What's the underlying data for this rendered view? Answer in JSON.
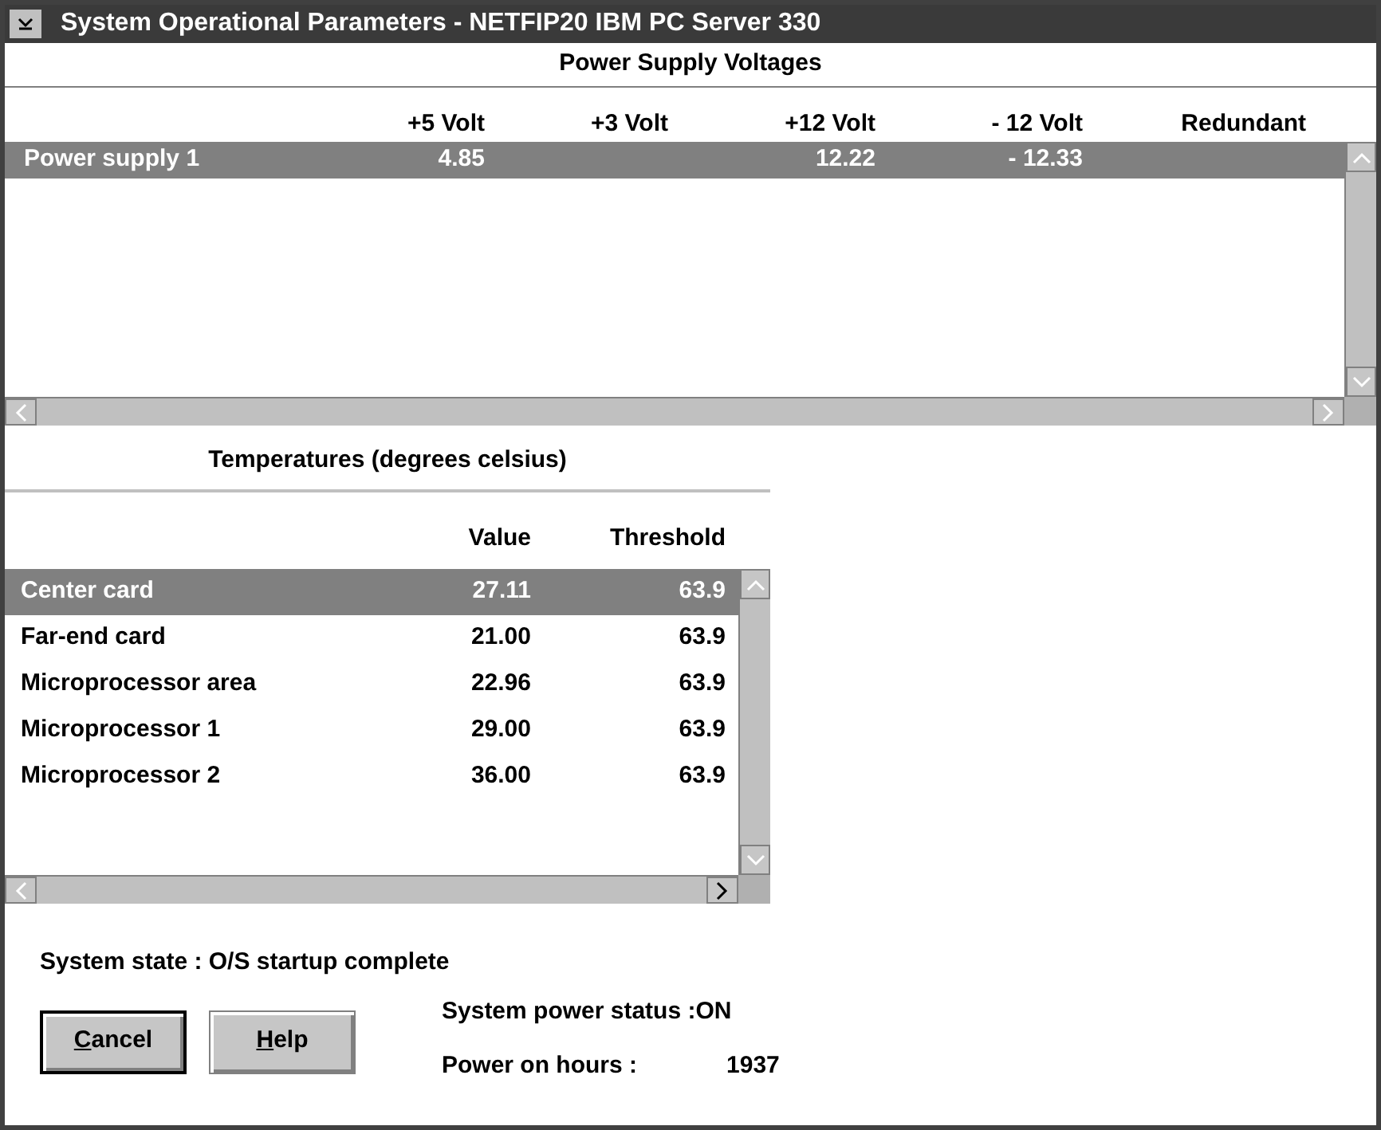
{
  "window": {
    "title": "System Operational Parameters - NETFIP20 IBM PC Server 330"
  },
  "power_supply": {
    "title": "Power Supply Voltages",
    "columns": [
      "+5 Volt",
      "+3 Volt",
      "+12 Volt",
      "- 12 Volt",
      "Redundant"
    ],
    "rows": [
      {
        "name": "Power supply 1",
        "cells": [
          "4.85",
          "",
          "12.22",
          "- 12.33",
          ""
        ],
        "selected": true
      }
    ]
  },
  "temperatures": {
    "title": "Temperatures (degrees celsius)",
    "columns": [
      "Value",
      "Threshold"
    ],
    "rows": [
      {
        "name": "Center card",
        "value": "27.11",
        "threshold": "63.9",
        "selected": true
      },
      {
        "name": "Far-end card",
        "value": "21.00",
        "threshold": "63.9",
        "selected": false
      },
      {
        "name": "Microprocessor area",
        "value": "22.96",
        "threshold": "63.9",
        "selected": false
      },
      {
        "name": "Microprocessor 1",
        "value": "29.00",
        "threshold": "63.9",
        "selected": false
      },
      {
        "name": "Microprocessor 2",
        "value": "36.00",
        "threshold": "63.9",
        "selected": false
      }
    ]
  },
  "system_state": "System state : O/S startup complete",
  "buttons": [
    {
      "label": "Cancel",
      "default": true
    },
    {
      "label": "Help",
      "default": false
    }
  ],
  "power_status": "System power status :ON",
  "power_hours": {
    "label": "Power on hours :",
    "value": "1937"
  }
}
